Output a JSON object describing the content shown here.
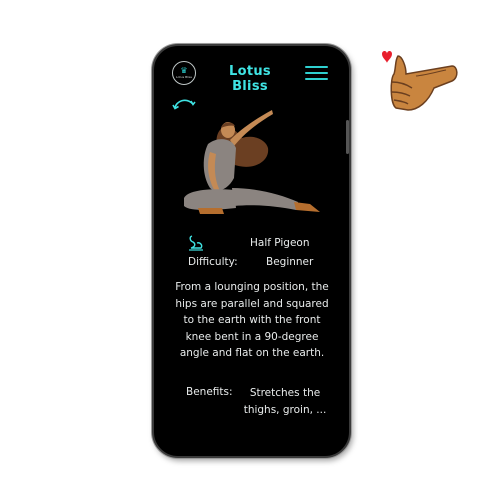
{
  "app": {
    "title": "Lotus Bliss",
    "logo_caption": "Lotus Bliss"
  },
  "pose": {
    "name": "Half Pigeon",
    "difficulty_label": "Difficulty:",
    "difficulty_value": "Beginner",
    "description": "From a lounging position, the hips are parallel and squared to the earth with the front knee bent in a 90-degree angle and flat on the earth.",
    "benefits_label": "Benefits:",
    "benefits_text": "Stretches the thighs, groin, ..."
  },
  "colors": {
    "accent": "#3fe3e3",
    "background": "#000000",
    "text": "#e9ecec"
  },
  "icons": [
    "logo-icon",
    "menu-icon",
    "back-arrow-icon",
    "pose-swan-icon",
    "thumbs-up-icon",
    "heart-icon"
  ]
}
